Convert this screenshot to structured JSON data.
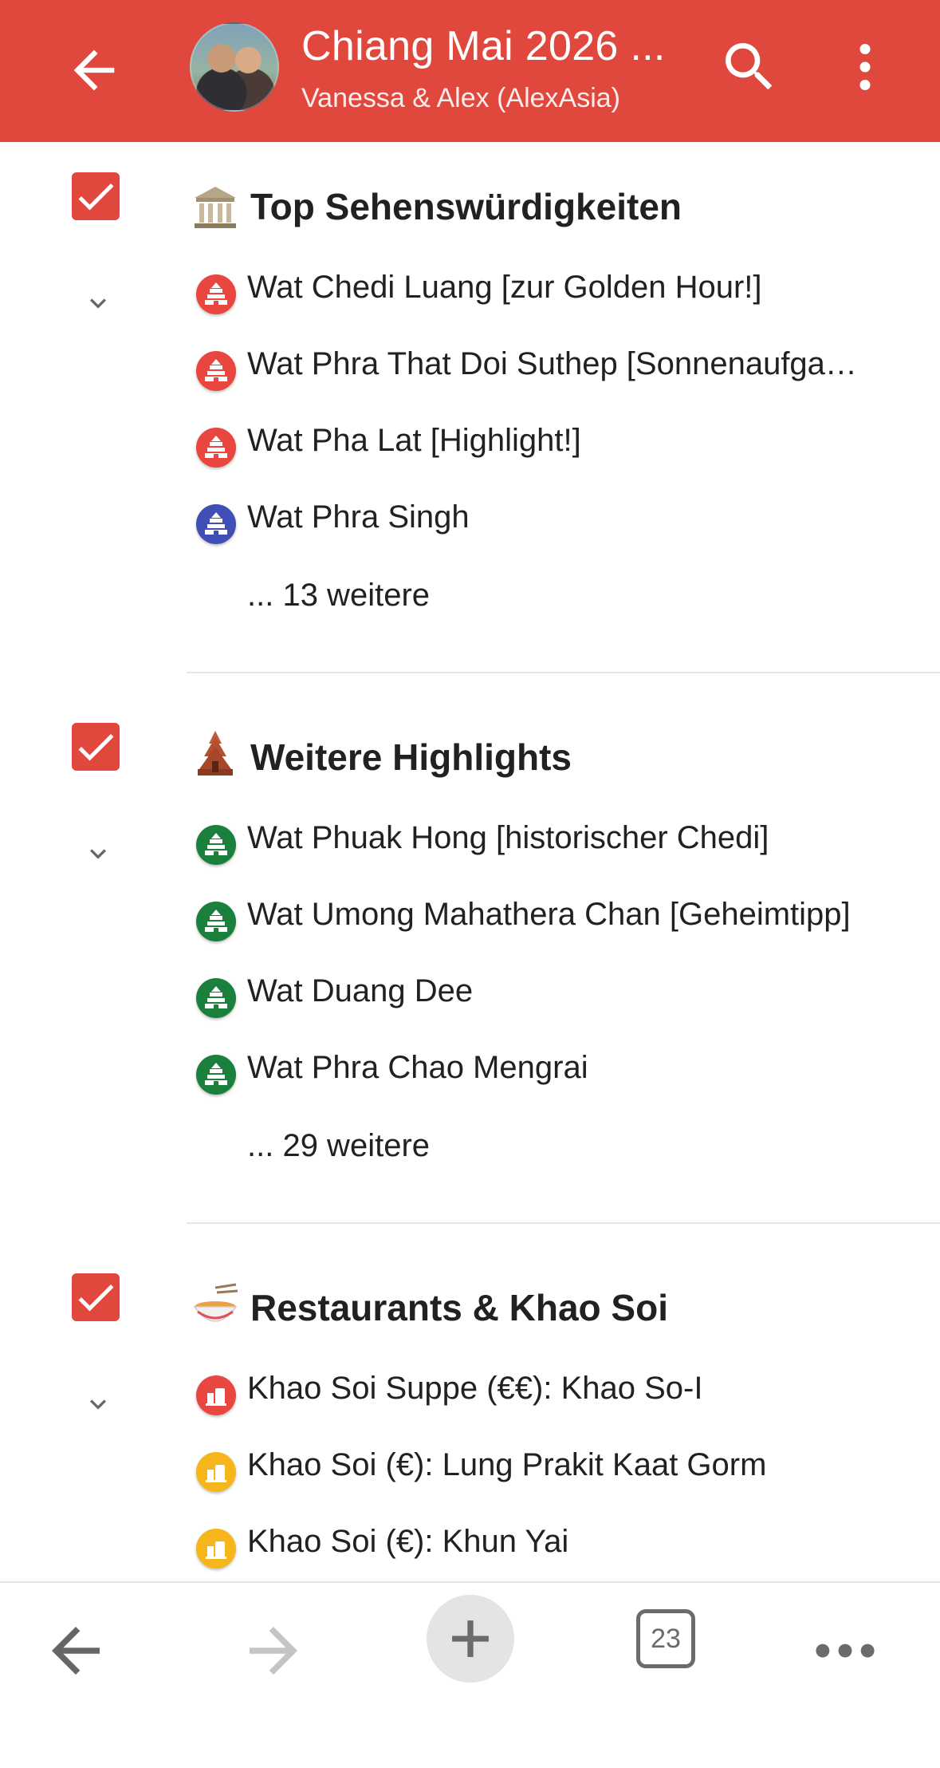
{
  "header": {
    "title": "Chiang Mai 2026 ...",
    "subtitle": "Vanessa & Alex (AlexAsia)",
    "icons": [
      "arrow-left-icon",
      "avatar",
      "search-icon",
      "more-vert-icon"
    ],
    "background_color": "#E0473D"
  },
  "sections": [
    {
      "title": "Top Sehenswürdigkeiten",
      "icon": "classical-building-icon",
      "checked": true,
      "items": [
        {
          "label": "Wat Chedi Luang [zur Golden Hour!]",
          "color": "#E8463F",
          "icon": "temple-icon"
        },
        {
          "label": "Wat Phra That Doi Suthep [Sonnenaufga…",
          "color": "#E8463F",
          "icon": "temple-icon"
        },
        {
          "label": "Wat Pha Lat [Highlight!]",
          "color": "#E8463F",
          "icon": "temple-icon"
        },
        {
          "label": "Wat Phra Singh",
          "color": "#3F4FB5",
          "icon": "temple-icon"
        }
      ],
      "more": "... 13 weitere"
    },
    {
      "title": "Weitere Highlights",
      "icon": "hindu-temple-icon",
      "checked": true,
      "items": [
        {
          "label": "Wat Phuak Hong [historischer Chedi]",
          "color": "#1B7F3E",
          "icon": "temple-icon"
        },
        {
          "label": "Wat Umong Mahathera Chan [Geheimtipp]",
          "color": "#1B7F3E",
          "icon": "temple-icon"
        },
        {
          "label": "Wat Duang Dee",
          "color": "#1B7F3E",
          "icon": "temple-icon"
        },
        {
          "label": "Wat Phra Chao Mengrai",
          "color": "#1B7F3E",
          "icon": "temple-icon"
        }
      ],
      "more": "... 29 weitere"
    },
    {
      "title": "Restaurants & Khao Soi",
      "icon": "noodle-bowl-icon",
      "checked": true,
      "items": [
        {
          "label": "Khao Soi Suppe (€€): Khao So-I",
          "color": "#E8463F",
          "icon": "restaurant-icon"
        },
        {
          "label": "Khao Soi (€): Lung Prakit Kaat Gorm",
          "color": "#F5B51B",
          "icon": "restaurant-icon"
        },
        {
          "label": "Khao Soi (€): Khun Yai",
          "color": "#F5B51B",
          "icon": "restaurant-icon"
        }
      ],
      "more": ""
    }
  ],
  "bottom_nav": {
    "tab_count": "23",
    "icons": [
      "back-arrow-icon",
      "forward-arrow-icon",
      "add-icon",
      "tabs-icon",
      "more-horiz-icon"
    ]
  }
}
